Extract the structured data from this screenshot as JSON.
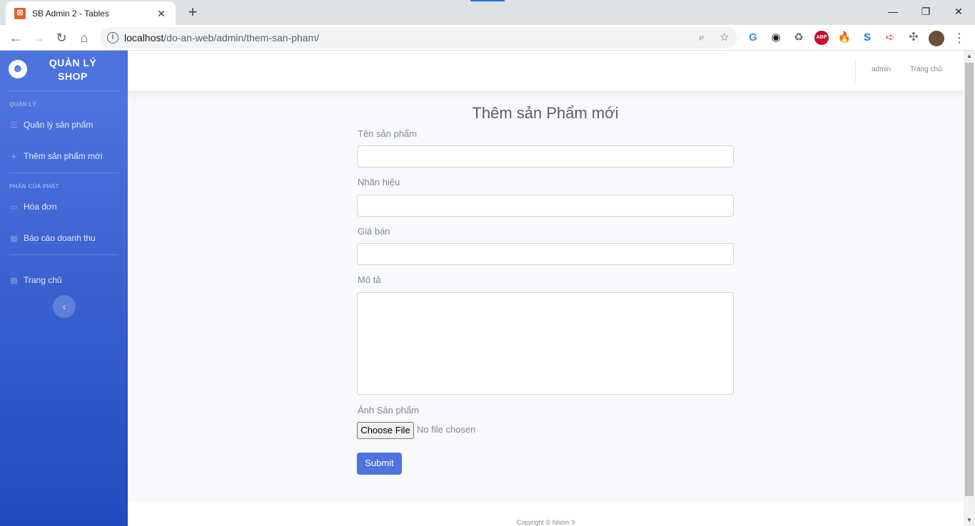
{
  "browser": {
    "tab_title": "SB Admin 2 - Tables",
    "url_host": "localhost",
    "url_path": "/do-an-web/admin/them-san-pham/",
    "extensions": [
      {
        "name": "translate-ext-icon",
        "glyph": "G",
        "color": "#4285f4"
      },
      {
        "name": "eye-off-ext-icon",
        "glyph": "◉",
        "color": "#202124"
      },
      {
        "name": "recycle-ext-icon",
        "glyph": "♻",
        "color": "#5f6368"
      },
      {
        "name": "adblock-ext-icon",
        "glyph": "ABP",
        "color": "#c70d2c"
      },
      {
        "name": "fire-ext-icon",
        "glyph": "🔥",
        "color": "#e8710a"
      },
      {
        "name": "s-ext-icon",
        "glyph": "S",
        "color": "#1a73e8"
      },
      {
        "name": "arrow-ext-icon",
        "glyph": "➪",
        "color": "#ea4335"
      }
    ]
  },
  "sidebar": {
    "brand_text": "QUẢN LÝ SHOP",
    "brand_icon": "laugh-wink-icon",
    "headings": [
      "QUẢN LÝ",
      "PHẦN CỦA PHÁT"
    ],
    "items": [
      {
        "label": "Quản lý sản phẩm",
        "icon": "list-icon"
      },
      {
        "label": "Thêm sản phẩm mới",
        "icon": "plus-icon"
      },
      {
        "label": "Hóa đơn",
        "icon": "money-bill-icon"
      },
      {
        "label": "Báo cáo doanh thu",
        "icon": "table-icon"
      },
      {
        "label": "Trang chủ",
        "icon": "table-icon"
      }
    ]
  },
  "topbar": {
    "user": "admin",
    "home": "Trang chủ"
  },
  "form": {
    "title": "Thêm sản Phẩm mới",
    "name_label": "Tên sản phẩm",
    "name_value": "",
    "brand_label": "Nhãn hiệu",
    "brand_value": "",
    "price_label": "Giá bán",
    "price_value": "",
    "desc_label": "Mô tả",
    "desc_value": "",
    "image_label": "Ảnh Sản phẩm",
    "file_button": "Choose File",
    "file_status": "No file chosen",
    "submit": "Submit"
  },
  "footer": {
    "copyright": "Copyright © Nhóm 9"
  },
  "colors": {
    "primary": "#4e73df",
    "sidebar_bottom": "#224abe",
    "page_bg": "#f8f9fc",
    "muted_text": "#858796"
  }
}
